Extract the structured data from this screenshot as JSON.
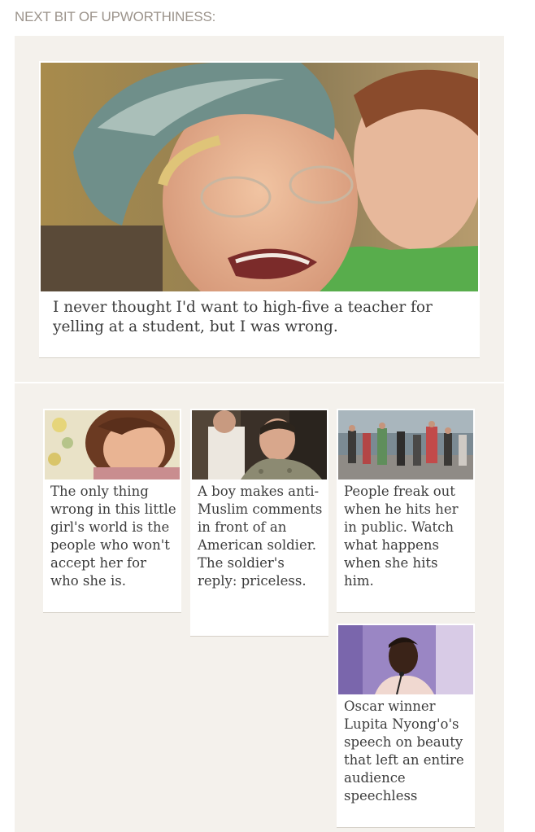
{
  "section": {
    "heading": "NEXT BIT OF UPWORTHINESS:"
  },
  "featured": {
    "title": "I never thought I'd want to high-five a teacher for yelling at a student, but I was wrong."
  },
  "stories": [
    {
      "title": "The only thing wrong in this little girl's world is the people who won't accept her for who she is."
    },
    {
      "title": "A boy makes anti-Muslim comments in front of an American soldier. The soldier's reply: priceless."
    },
    {
      "title": "People freak out when he hits her in public. Watch what happens when she hits him."
    },
    {
      "title": "Oscar winner Lupita Nyong'o's speech on beauty that left an entire audience speechless"
    }
  ]
}
